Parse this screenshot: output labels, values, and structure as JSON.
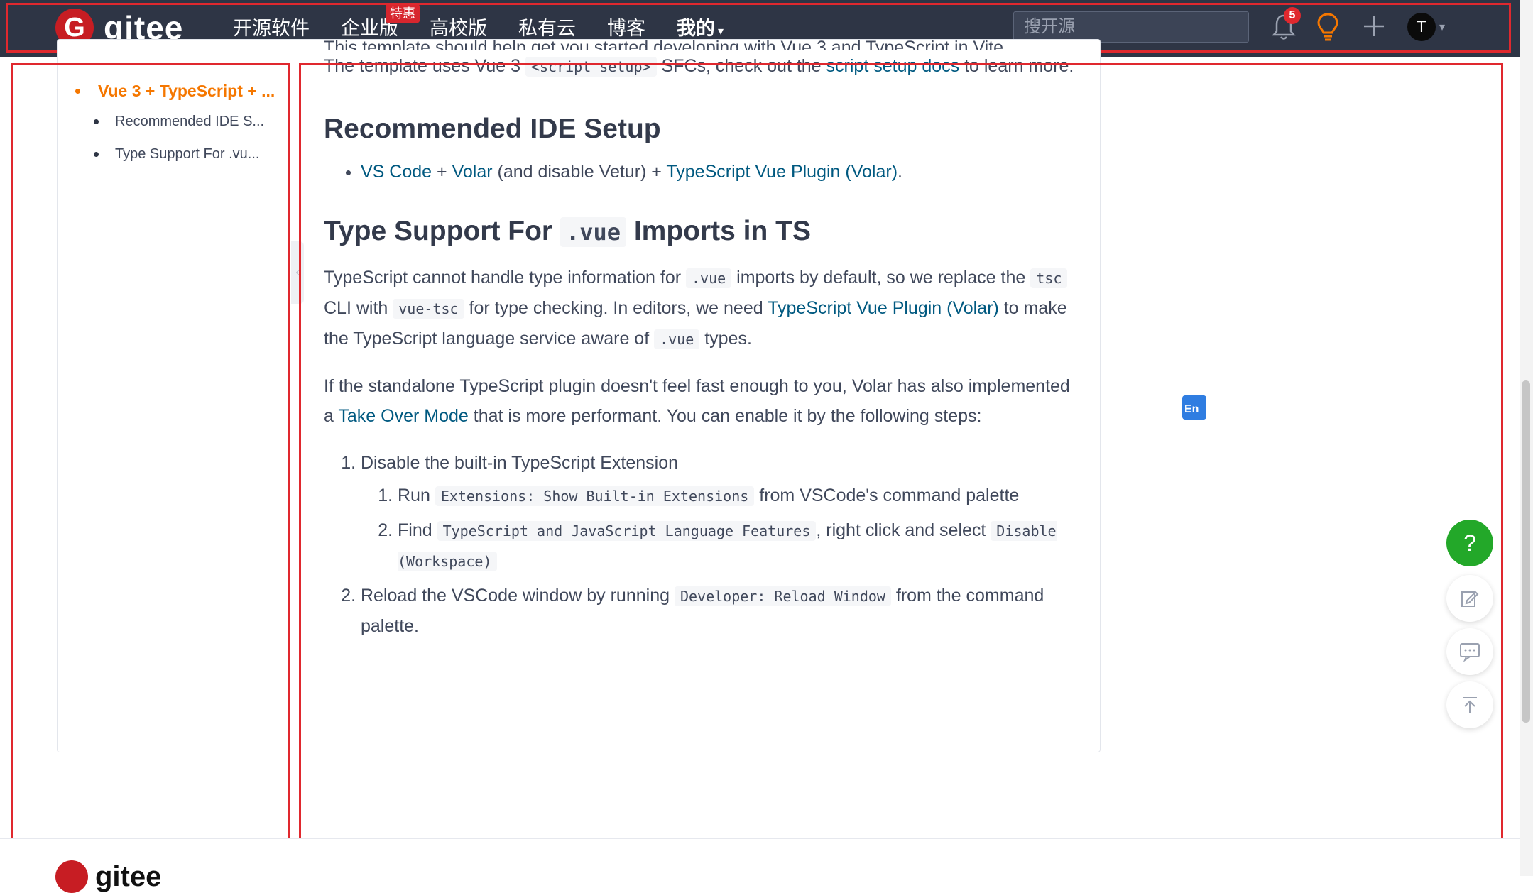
{
  "nav": {
    "logo_text": "gitee",
    "items": [
      {
        "label": "开源软件"
      },
      {
        "label": "企业版",
        "badge": "特惠"
      },
      {
        "label": "高校版"
      },
      {
        "label": "私有云"
      },
      {
        "label": "博客"
      },
      {
        "label": "我的"
      }
    ],
    "search_placeholder": "搜开源",
    "notification_count": "5",
    "avatar_letter": "T"
  },
  "toc": {
    "items": [
      {
        "label": "Vue 3 + TypeScript + ...",
        "active": true
      },
      {
        "label": "Recommended IDE S..."
      },
      {
        "label": "Type Support For .vu..."
      }
    ]
  },
  "article": {
    "intro_cut": "This template should help get you started developing with Vue 3 and TypeScript in Vite.",
    "intro_a": "The template uses Vue 3 ",
    "intro_code": "<script setup>",
    "intro_b": " SFCs, check out the ",
    "intro_link": "script setup docs",
    "intro_c": " to learn more.",
    "h_ide": "Recommended IDE Setup",
    "ide_link1": "VS Code",
    "ide_plus1": " + ",
    "ide_link2": "Volar",
    "ide_mid": " (and disable Vetur) + ",
    "ide_link3": "TypeScript Vue Plugin (Volar)",
    "ide_end": ".",
    "h_type_a": "Type Support For ",
    "h_type_code": ".vue",
    "h_type_b": " Imports in TS",
    "p1_a": "TypeScript cannot handle type information for ",
    "p1_code1": ".vue",
    "p1_b": " imports by default, so we replace the ",
    "p1_code2": "tsc",
    "p1_c": " CLI with ",
    "p1_code3": "vue-tsc",
    "p1_d": " for type checking. In editors, we need ",
    "p1_link": "TypeScript Vue Plugin (Volar)",
    "p1_e": " to make the TypeScript language service aware of ",
    "p1_code4": ".vue",
    "p1_f": " types.",
    "p2_a": "If the standalone TypeScript plugin doesn't feel fast enough to you, Volar has also implemented a ",
    "p2_link": "Take Over Mode",
    "p2_b": " that is more performant. You can enable it by the following steps:",
    "step1": "Disable the built-in TypeScript Extension",
    "step1a_a": "Run ",
    "step1a_code": "Extensions: Show Built-in Extensions",
    "step1a_b": " from VSCode's command palette",
    "step1b_a": "Find ",
    "step1b_code1": "TypeScript and JavaScript Language Features",
    "step1b_b": ", right click and select ",
    "step1b_code2": "Disable (Workspace)",
    "step2_a": "Reload the VSCode window by running ",
    "step2_code": "Developer: Reload Window",
    "step2_b": " from the command palette."
  },
  "floating": {
    "help_glyph": "?"
  },
  "footer": {
    "logo_text": "gitee"
  },
  "colors": {
    "nav_bg": "#2e3545",
    "accent_orange": "#f57700",
    "link": "#005980",
    "help_green": "#23a829",
    "brand_red": "#c71d23"
  }
}
